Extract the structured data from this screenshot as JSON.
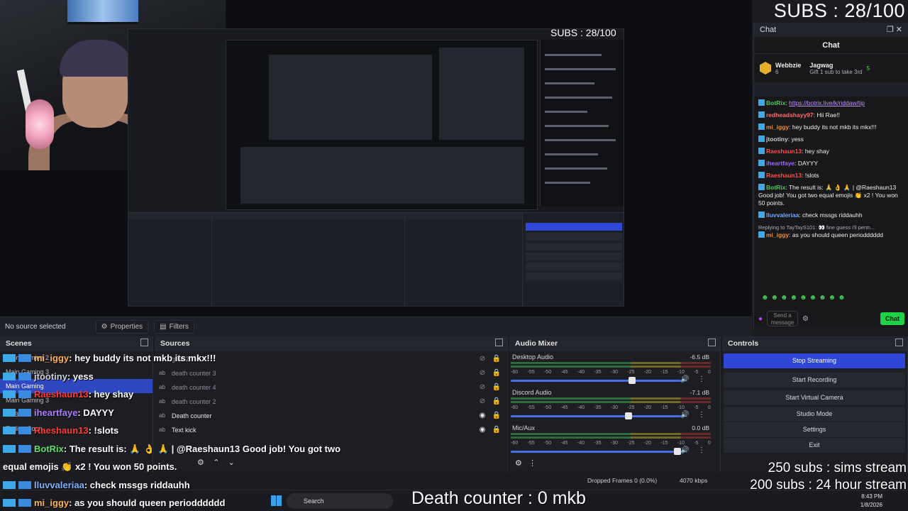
{
  "subs_counter": "SUBS : 28/100",
  "nested_subs": "SUBS : 28/100",
  "death_counter": "Death counter : 0 mkb",
  "overlay_subs": [
    "250 subs : sims stream",
    "200 subs : 24 hour stream"
  ],
  "chat_dock": {
    "title": "Chat",
    "header": "Chat",
    "pinned": {
      "user1": "Webbzie",
      "user1_count": "6",
      "user2": "Jagwag",
      "user2_count": "5",
      "gift_text": "Gift 1 sub to take 3rd"
    },
    "messages": [
      {
        "user": "BotRix",
        "color": "#47c75a",
        "text": "",
        "link": "https://botrix.live/k/riddaw/tip"
      },
      {
        "user": "redheadshayy97",
        "color": "#ff6b6b",
        "text": "Hii Rae!!",
        "link": ""
      },
      {
        "user": "mi_iggy",
        "color": "#e88f3b",
        "text": "hey buddy its not mkb its mkx!!!",
        "link": ""
      },
      {
        "user": "jtootiny",
        "color": "#c9c9d0",
        "text": "yess",
        "link": ""
      },
      {
        "user": "Raeshaun13",
        "color": "#ff4d4d",
        "text": "hey shay",
        "link": ""
      },
      {
        "user": "iheartfaye",
        "color": "#9d6bff",
        "text": "DAYYY",
        "link": ""
      },
      {
        "user": "Raeshaun13",
        "color": "#ff4d4d",
        "text": "!slots",
        "link": ""
      },
      {
        "user": "BotRix",
        "color": "#47c75a",
        "text": "The result is: 🙏 👌 🙏 | @Raeshaun13 Good job! You got two equal emojis 👏 x2 ! You won 50 points.",
        "link": ""
      },
      {
        "user": "lluvvaleriaa",
        "color": "#6fa8ff",
        "text": "check mssgs riddauhh",
        "link": ""
      },
      {
        "user": "mi_iggy",
        "color": "#e88f3b",
        "text": "as you should queen periodddddd",
        "link": "",
        "reply": "Replying to TayTayS101: 👀 fine guess i'll perm..."
      }
    ],
    "input_placeholder": "Send a message",
    "chat_button": "Chat"
  },
  "props_bar": {
    "no_source": "No source selected",
    "properties": "Properties",
    "filters": "Filters"
  },
  "scenes": {
    "title": "Scenes",
    "items": [
      "Main Gaming 2",
      "Main Gaming 3",
      "Main Gaming",
      "Main Gaming 3",
      "BRB",
      "Ending Soon"
    ]
  },
  "sources": {
    "title": "Sources",
    "items": [
      {
        "type": "ab",
        "name": "goal 2",
        "active": false
      },
      {
        "type": "ab",
        "name": "death counter 3",
        "active": false
      },
      {
        "type": "ab",
        "name": "death counter 4",
        "active": false
      },
      {
        "type": "ab",
        "name": "death counter 2",
        "active": false
      },
      {
        "type": "ab",
        "name": "Death counter",
        "active": true
      },
      {
        "type": "ab",
        "name": "Text kick",
        "active": true
      }
    ]
  },
  "mixer": {
    "title": "Audio Mixer",
    "ticks": [
      "-60",
      "-55",
      "-50",
      "-45",
      "-40",
      "-35",
      "-30",
      "-25",
      "-20",
      "-15",
      "-10",
      "-5",
      "0"
    ],
    "channels": [
      {
        "name": "Desktop Audio",
        "db": "-6.5 dB",
        "level": 0.72
      },
      {
        "name": "Discord Audio",
        "db": "-7.1 dB",
        "level": 0.7
      },
      {
        "name": "Mic/Aux",
        "db": "0.0 dB",
        "level": 1.0
      }
    ]
  },
  "controls": {
    "title": "Controls",
    "buttons": [
      "Stop Streaming",
      "Start Recording",
      "Start Virtual Camera",
      "Studio Mode",
      "Settings",
      "Exit"
    ]
  },
  "overlay_chat": [
    {
      "user": "mi_iggy",
      "color": "#ffb347",
      "text": ": hey buddy its not mkb its mkx!!!"
    },
    {
      "user": "jtootiny",
      "color": "#d0d0d8",
      "text": ": yess"
    },
    {
      "user": "Raeshaun13",
      "color": "#ff3b3b",
      "text": ": hey shay"
    },
    {
      "user": "iheartfaye",
      "color": "#b07bff",
      "text": ": DAYYY"
    },
    {
      "user": "Raeshaun13",
      "color": "#ff3b3b",
      "text": ": !slots"
    },
    {
      "user": "BotRix",
      "color": "#5fe36a",
      "text": ": The result is: 🙏 👌 🙏 | @Raeshaun13 Good job! You got two"
    },
    {
      "user": "",
      "color": "#ffffff",
      "text": "equal emojis 👏 x2 ! You won 50 points."
    },
    {
      "user": "lluvvaleriaa",
      "color": "#7fb2ff",
      "text": ": check mssgs riddauhh"
    },
    {
      "user": "mi_iggy",
      "color": "#ffb347",
      "text": ": as you should queen periodddddd"
    }
  ],
  "status": {
    "dropped_frames": "Dropped Frames 0 (0.0%)",
    "kbps": "4070 kbps"
  },
  "taskbar": {
    "search": "Search",
    "time": "8:43 PM",
    "date": "1/8/2026"
  }
}
